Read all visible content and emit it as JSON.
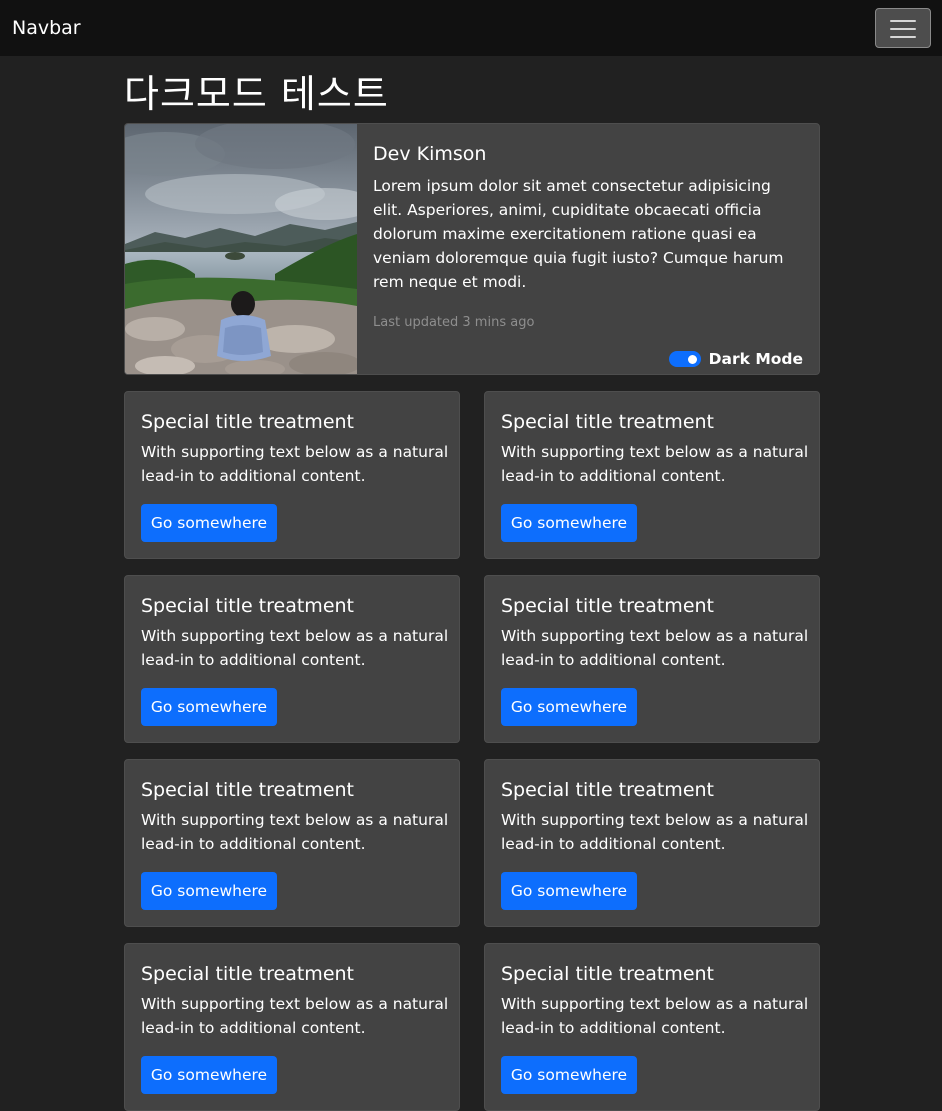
{
  "navbar": {
    "brand": "Navbar",
    "toggler_icon": "hamburger-menu-icon"
  },
  "page": {
    "title": "다크모드 테스트"
  },
  "profile": {
    "photo_alt": "person-sitting-by-lake-photo",
    "name": "Dev Kimson",
    "text": "Lorem ipsum dolor sit amet consectetur adipisicing elit. Asperiores, animi, cupiditate obcaecati officia dolorum maxime exercitationem ratione quasi ea veniam doloremque quia fugit iusto? Cumque harum rem neque et modi.",
    "updated": "Last updated 3 mins ago",
    "dark_mode_label": "Dark Mode",
    "dark_mode_on": true
  },
  "cards": [
    {
      "title": "Special title treatment",
      "text": "With supporting text below as a natural lead-in to additional content.",
      "button": "Go somewhere"
    },
    {
      "title": "Special title treatment",
      "text": "With supporting text below as a natural lead-in to additional content.",
      "button": "Go somewhere"
    },
    {
      "title": "Special title treatment",
      "text": "With supporting text below as a natural lead-in to additional content.",
      "button": "Go somewhere"
    },
    {
      "title": "Special title treatment",
      "text": "With supporting text below as a natural lead-in to additional content.",
      "button": "Go somewhere"
    },
    {
      "title": "Special title treatment",
      "text": "With supporting text below as a natural lead-in to additional content.",
      "button": "Go somewhere"
    },
    {
      "title": "Special title treatment",
      "text": "With supporting text below as a natural lead-in to additional content.",
      "button": "Go somewhere"
    },
    {
      "title": "Special title treatment",
      "text": "With supporting text below as a natural lead-in to additional content.",
      "button": "Go somewhere"
    },
    {
      "title": "Special title treatment",
      "text": "With supporting text below as a natural lead-in to additional content.",
      "button": "Go somewhere"
    }
  ],
  "colors": {
    "background": "#212121",
    "navbar": "#111111",
    "card": "#434343",
    "primary": "#0d6efd",
    "muted": "#8e8e8e"
  }
}
